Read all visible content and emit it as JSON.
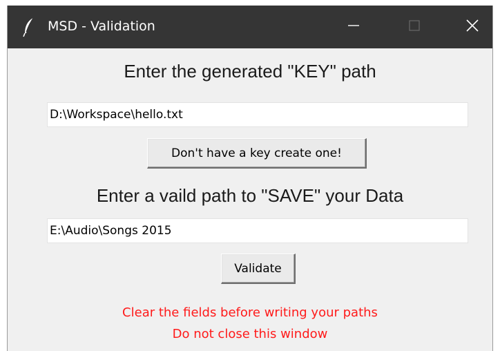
{
  "window": {
    "title": "MSD - Validation",
    "icon": "feather-icon",
    "controls": [
      "minimize-icon",
      "maximize-icon",
      "close-icon"
    ]
  },
  "key_section": {
    "heading": "Enter the generated \"KEY\" path",
    "input_value": "D:\\Workspace\\hello.txt",
    "create_button_label": "Don't have a key create one!"
  },
  "save_section": {
    "heading": "Enter a vaild path to \"SAVE\" your Data",
    "input_value": "E:\\Audio\\Songs 2015",
    "validate_button_label": "Validate"
  },
  "warnings": {
    "line1": "Clear the fields before writing your paths",
    "line2": "Do not close this window"
  },
  "colors": {
    "titlebar": "#353535",
    "window_bg": "#f0f0f0",
    "warning_text": "#ff1a1a"
  }
}
